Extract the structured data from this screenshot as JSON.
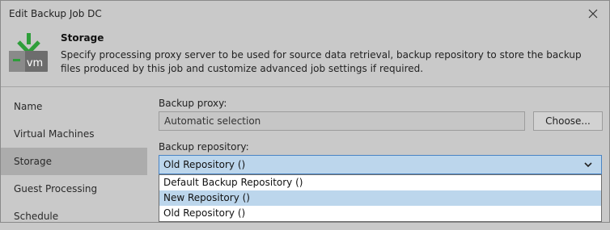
{
  "window": {
    "title": "Edit Backup Job DC"
  },
  "header": {
    "title": "Storage",
    "description": "Specify processing proxy server to be used for source data retrieval, backup repository to store the backup files produced by this job and customize advanced job settings if required.",
    "icon_text": "vm"
  },
  "sidebar": {
    "items": [
      {
        "label": "Name"
      },
      {
        "label": "Virtual Machines"
      },
      {
        "label": "Storage"
      },
      {
        "label": "Guest Processing"
      },
      {
        "label": "Schedule"
      }
    ]
  },
  "content": {
    "proxy_label": "Backup proxy:",
    "proxy_value": "Automatic selection",
    "choose_label": "Choose...",
    "repo_label": "Backup repository:",
    "repo_selected": "Old Repository ()",
    "repo_options": [
      {
        "label": "Default Backup Repository ()"
      },
      {
        "label": "New Repository ()"
      },
      {
        "label": "Old Repository ()"
      }
    ]
  }
}
